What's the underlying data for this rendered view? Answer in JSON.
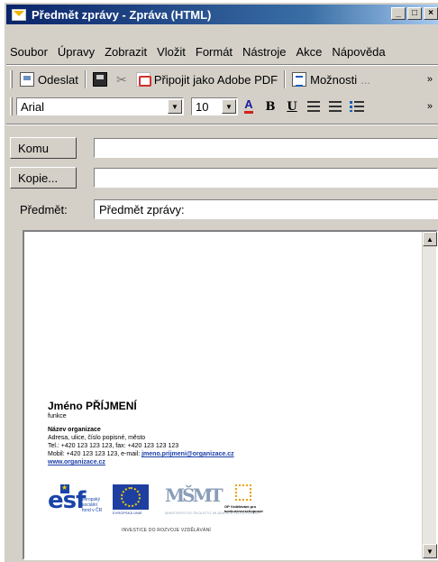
{
  "window": {
    "title": "Předmět zprávy - Zpráva (HTML)",
    "buttons": [
      "_",
      "□",
      "×"
    ]
  },
  "menu": [
    "Soubor",
    "Úpravy",
    "Zobrazit",
    "Vložit",
    "Formát",
    "Nástroje",
    "Akce",
    "Nápověda"
  ],
  "toolbar": {
    "send": "Odeslat",
    "attach_pdf": "Připojit jako Adobe PDF",
    "options": "Možnosti",
    "options_suffix": "..."
  },
  "format": {
    "font": "Arial",
    "size": "10",
    "bold": "B",
    "underline": "U"
  },
  "address": {
    "to_label": "Komu",
    "cc_label": "Kopie...",
    "subject_label": "Předmět:",
    "subject_value": "Předmět zprávy:"
  },
  "signature": {
    "name": "Jméno PŘÍJMENÍ",
    "role": "funkce",
    "org": "Název organizace",
    "address": "Adresa, ulice, číslo popisné, město",
    "phone": "Tel.: +420 123 123 123, fax: +420 123 123 123",
    "mobile_prefix": "Mobil: +420 123 123 123, e-mail: ",
    "email": "jmeno.prijmeni@organizace.cz",
    "web": "www.organizace.cz"
  },
  "logos": {
    "esf": "esf",
    "esf_sub": "evropský sociální fond v ČR",
    "eu": "EVROPSKÁ UNIE",
    "msmt": "MŠMT",
    "msmt_sub": "MINISTERSTVO ŠKOLSTVÍ, MLÁDEŽE A TĚLOVÝCHOVY",
    "op": "OP Vzdělávání pro konkurenceschopnost",
    "invest": "INVESTICE DO ROZVOJE VZDĚLÁVÁNÍ"
  },
  "colors": {
    "title_start": "#0a246a",
    "title_end": "#a6caf0",
    "chrome": "#d4d0c8",
    "link": "#1a3fa8"
  }
}
